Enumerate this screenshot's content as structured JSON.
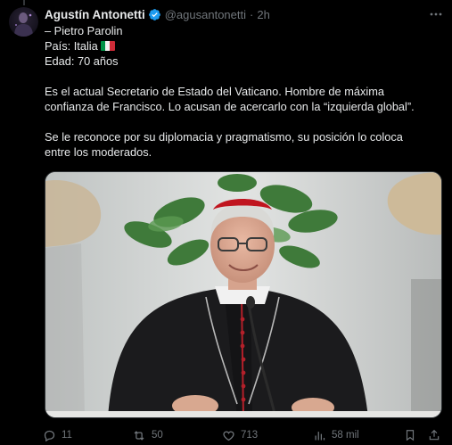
{
  "author": {
    "name": "Agustín Antonetti",
    "handle": "@agusantonetti",
    "separator": "·",
    "time": "2h",
    "verified_color": "#1d9bf0"
  },
  "tweet": {
    "lines": [
      "– Pietro Parolin",
      "País: Italia",
      "Edad: 70 años",
      "Es el actual Secretario de Estado del Vaticano. Hombre de máxima",
      "confianza de Francisco. Lo acusan de acercarlo con la “izquierda global”.",
      "Se le reconoce por su diplomacia y pragmatismo, su posición lo coloca",
      "entre los moderados."
    ]
  },
  "actions": {
    "replies": "11",
    "retweets": "50",
    "likes": "713",
    "views": "58 mil"
  },
  "icons": {
    "reply": "reply-icon",
    "retweet": "retweet-icon",
    "like": "heart-icon",
    "views": "views-icon",
    "bookmark": "bookmark-icon",
    "share": "share-icon",
    "more": "more-icon"
  },
  "colors": {
    "background": "#000000",
    "text": "#e7e9ea",
    "muted": "#71767b",
    "accent": "#1d9bf0"
  }
}
